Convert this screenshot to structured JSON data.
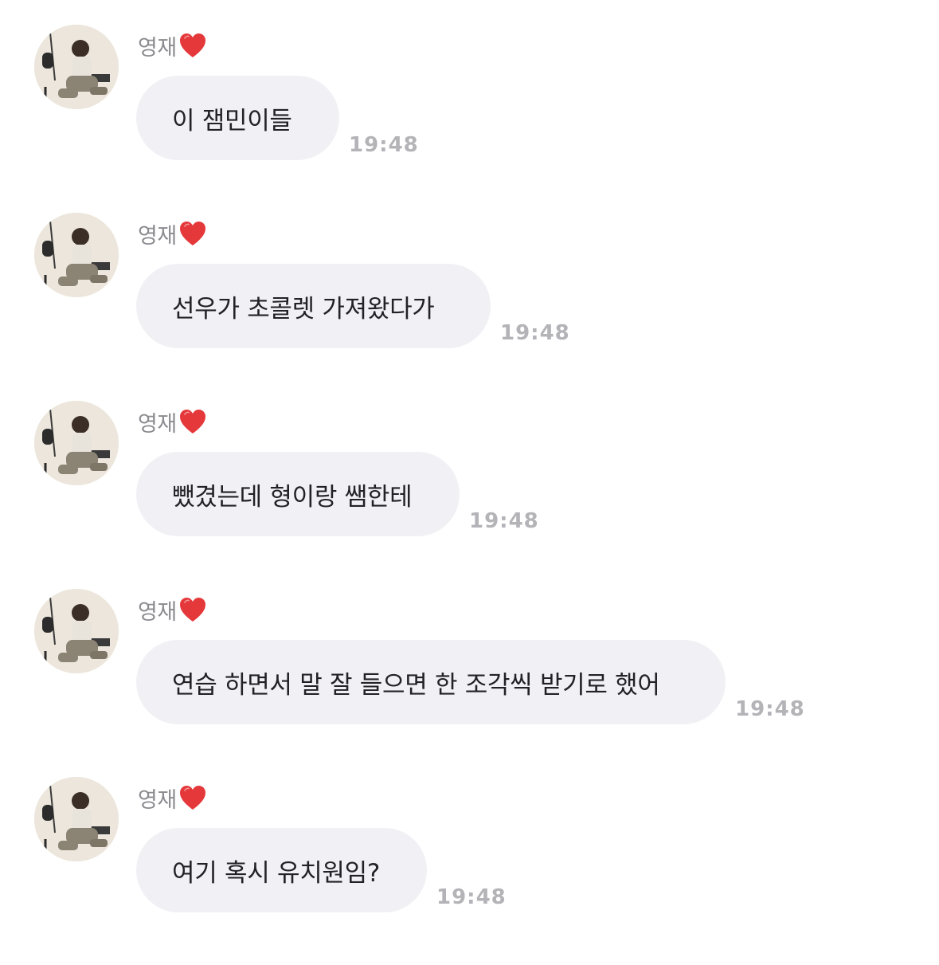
{
  "messages": [
    {
      "sender": "영재",
      "text": "이 잼민이들",
      "time": "19:48"
    },
    {
      "sender": "영재",
      "text": "선우가 초콜렛 가져왔다가",
      "time": "19:48"
    },
    {
      "sender": "영재",
      "text": "뺐겼는데 형이랑 쌤한테",
      "time": "19:48"
    },
    {
      "sender": "영재",
      "text": "연습 하면서 말 잘 들으면 한 조각씩 받기로 했어",
      "time": "19:48"
    },
    {
      "sender": "영재",
      "text": "여기 혹시 유치원임?",
      "time": "19:48"
    }
  ],
  "icons": {
    "heart": "red-heart-icon",
    "avatar": "profile-photo"
  },
  "colors": {
    "heart": "#e5383b",
    "bubble": "#f1f1f5",
    "sender": "#8b8b90",
    "time": "#b3b3b8",
    "text": "#222226"
  }
}
